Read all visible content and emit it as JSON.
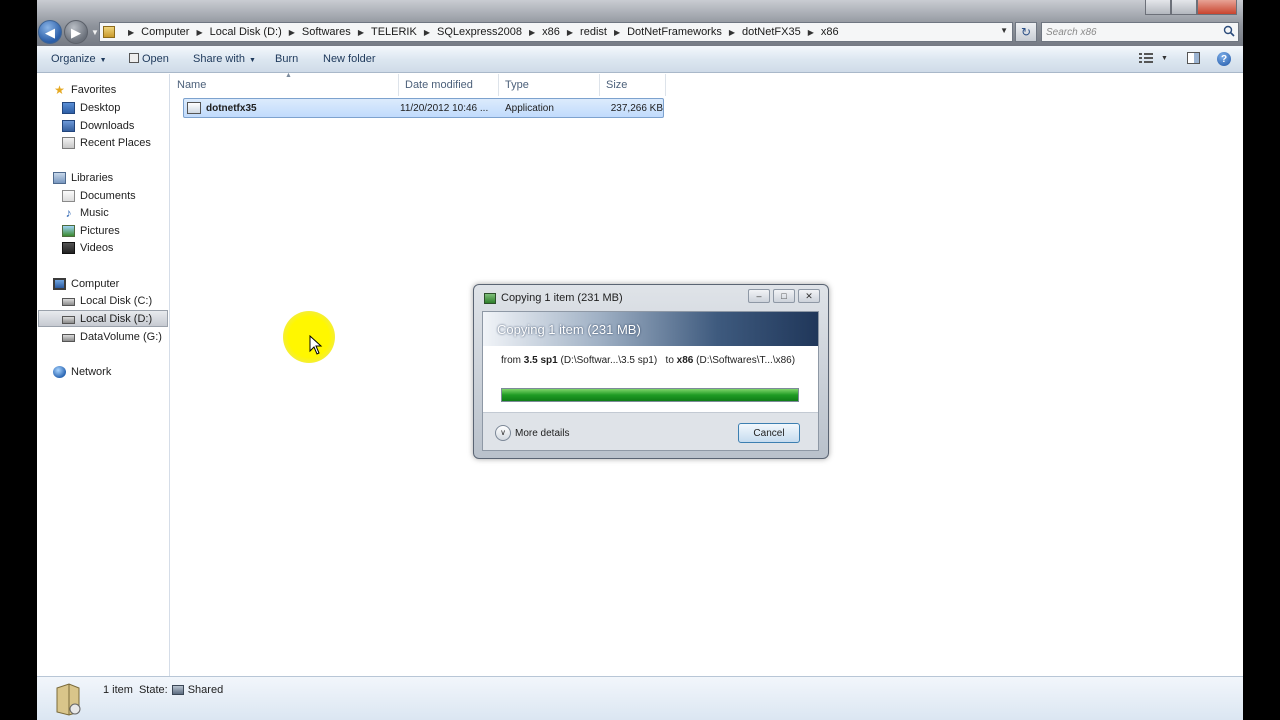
{
  "window": {
    "breadcrumb": [
      "Computer",
      "Local Disk (D:)",
      "Softwares",
      "TELERIK",
      "SQLexpress2008",
      "x86",
      "redist",
      "DotNetFrameworks",
      "dotNetFX35",
      "x86"
    ],
    "search_placeholder": "Search x86"
  },
  "toolbar": {
    "organize": "Organize",
    "open": "Open",
    "share_with": "Share with",
    "burn": "Burn",
    "new_folder": "New folder"
  },
  "nav": {
    "favorites": {
      "label": "Favorites",
      "items": [
        "Desktop",
        "Downloads",
        "Recent Places"
      ]
    },
    "libraries": {
      "label": "Libraries",
      "items": [
        "Documents",
        "Music",
        "Pictures",
        "Videos"
      ]
    },
    "computer": {
      "label": "Computer",
      "items": [
        "Local Disk (C:)",
        "Local Disk (D:)",
        "DataVolume (G:)"
      ]
    },
    "network": {
      "label": "Network"
    }
  },
  "columns": {
    "name": "Name",
    "date_modified": "Date modified",
    "type": "Type",
    "size": "Size"
  },
  "files": [
    {
      "name": "dotnetfx35",
      "date": "11/20/2012 10:46 ...",
      "type": "Application",
      "size": "237,266 KB"
    }
  ],
  "dialog": {
    "title": "Copying 1 item (231 MB)",
    "banner": "Copying 1 item (231 MB)",
    "from_label": "from",
    "from_name": "3.5 sp1",
    "from_path": "(D:\\Softwar...\\3.5 sp1)",
    "to_label": "to",
    "to_name": "x86",
    "to_path": "(D:\\Softwares\\T...\\x86)",
    "progress": 1.0,
    "more_details": "More details",
    "cancel": "Cancel"
  },
  "status": {
    "count": "1 item",
    "state_label": "State:",
    "state_value": "Shared"
  }
}
